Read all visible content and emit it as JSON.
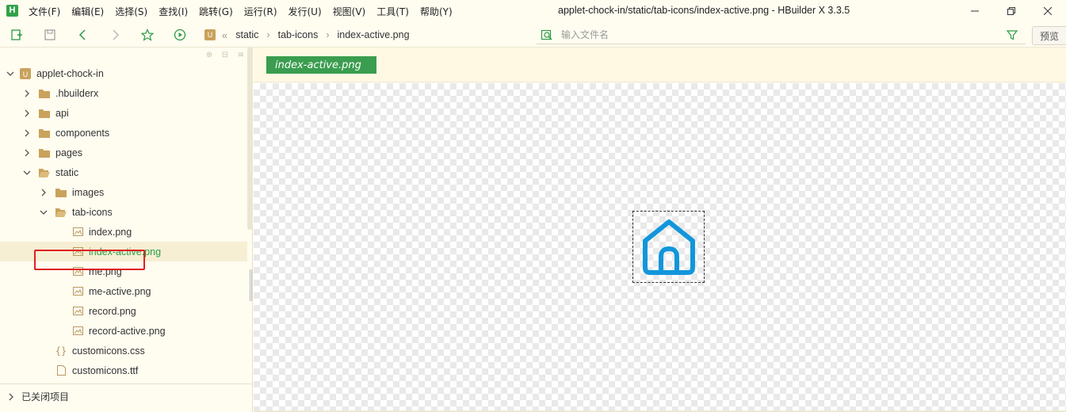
{
  "app": {
    "logo_letter": "H",
    "window_title": "applet-chock-in/static/tab-icons/index-active.png - HBuilder X 3.3.5"
  },
  "menu": [
    "文件(F)",
    "编辑(E)",
    "选择(S)",
    "查找(I)",
    "跳转(G)",
    "运行(R)",
    "发行(U)",
    "视图(V)",
    "工具(T)",
    "帮助(Y)"
  ],
  "breadcrumb": {
    "logo_letter": "U",
    "items": [
      "static",
      "tab-icons",
      "index-active.png"
    ]
  },
  "file_search": {
    "placeholder": "输入文件名"
  },
  "preview_label": "预览",
  "tree": {
    "project": "applet-chock-in",
    "items": [
      {
        "label": ".hbuilderx"
      },
      {
        "label": "api"
      },
      {
        "label": "components"
      },
      {
        "label": "pages"
      },
      {
        "label": "static"
      },
      {
        "label": "images"
      },
      {
        "label": "tab-icons"
      },
      {
        "label": "index.png"
      },
      {
        "label": "index-active.png"
      },
      {
        "label": "me.png"
      },
      {
        "label": "me-active.png"
      },
      {
        "label": "record.png"
      },
      {
        "label": "record-active.png"
      },
      {
        "label": "customicons.css"
      },
      {
        "label": "customicons.ttf"
      }
    ],
    "closed_projects": "已关闭项目"
  },
  "editor": {
    "file_tag": "index-active.png"
  },
  "colors": {
    "accent": "#3a9d4f",
    "icon_blue": "#1296db",
    "highlight": "#e02020",
    "folder": "#c9a25b"
  }
}
